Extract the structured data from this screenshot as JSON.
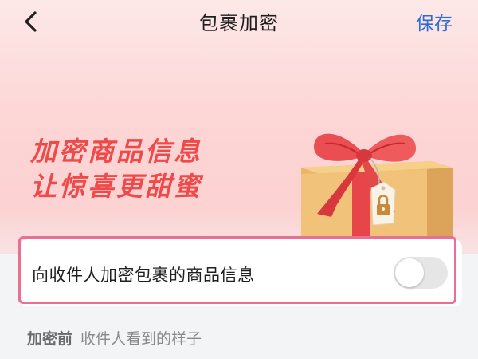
{
  "nav": {
    "title": "包裹加密",
    "save_label": "保存"
  },
  "hero": {
    "slogan_line1": "加密商品信息",
    "slogan_line2": "让惊喜更甜蜜"
  },
  "setting": {
    "label": "向收件人加密包裹的商品信息",
    "enabled": false
  },
  "section": {
    "title": "加密前",
    "subtitle": "收件人看到的样子"
  },
  "colors": {
    "accent": "#2f6bd8",
    "slogan": "#ef4a4a",
    "highlight": "#ea6f93"
  }
}
